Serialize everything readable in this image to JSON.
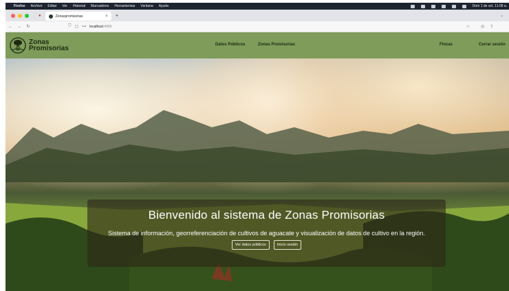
{
  "menubar": {
    "app": "Firefox",
    "items": [
      "Archivo",
      "Editar",
      "Ver",
      "Historial",
      "Marcadores",
      "Herramientas",
      "Ventana",
      "Ayuda"
    ],
    "clock": "Dom 1 de oct.  11:09 a."
  },
  "browser": {
    "tab_title": "Zonaspromisorias",
    "tab_close": "×",
    "new_tab": "+",
    "url_prefix": "localhost",
    "url_port": ":4000"
  },
  "header": {
    "brand_line1": "Zonas",
    "brand_line2": "Promisorias",
    "nav": {
      "datos_publicos": "Datos Públicos",
      "zonas_promisorias": "Zonas Promisorias",
      "fincas": "Fincas",
      "cerrar_sesion": "Cerrar sesión"
    }
  },
  "hero": {
    "title": "Bienvenido al sistema de Zonas Promisorias",
    "description": "Sistema de información, georreferenciación de cultivos de aguacate y visualización de datos de cultivo en la región.",
    "btn_public": "Ver datos públicos",
    "btn_login": "Inicio sesión"
  },
  "colors": {
    "header_bg": "#7f9c5a",
    "menubar_bg": "#1d2430",
    "overlay_bg": "rgba(45,38,24,0.62)"
  },
  "icons": [
    "apple-icon",
    "traffic-lights",
    "tab-favicon",
    "back-icon",
    "forward-icon",
    "reload-icon",
    "shield-icon",
    "page-icon",
    "star-icon",
    "pocket-icon",
    "share-icon",
    "avocado-tree-logo"
  ]
}
